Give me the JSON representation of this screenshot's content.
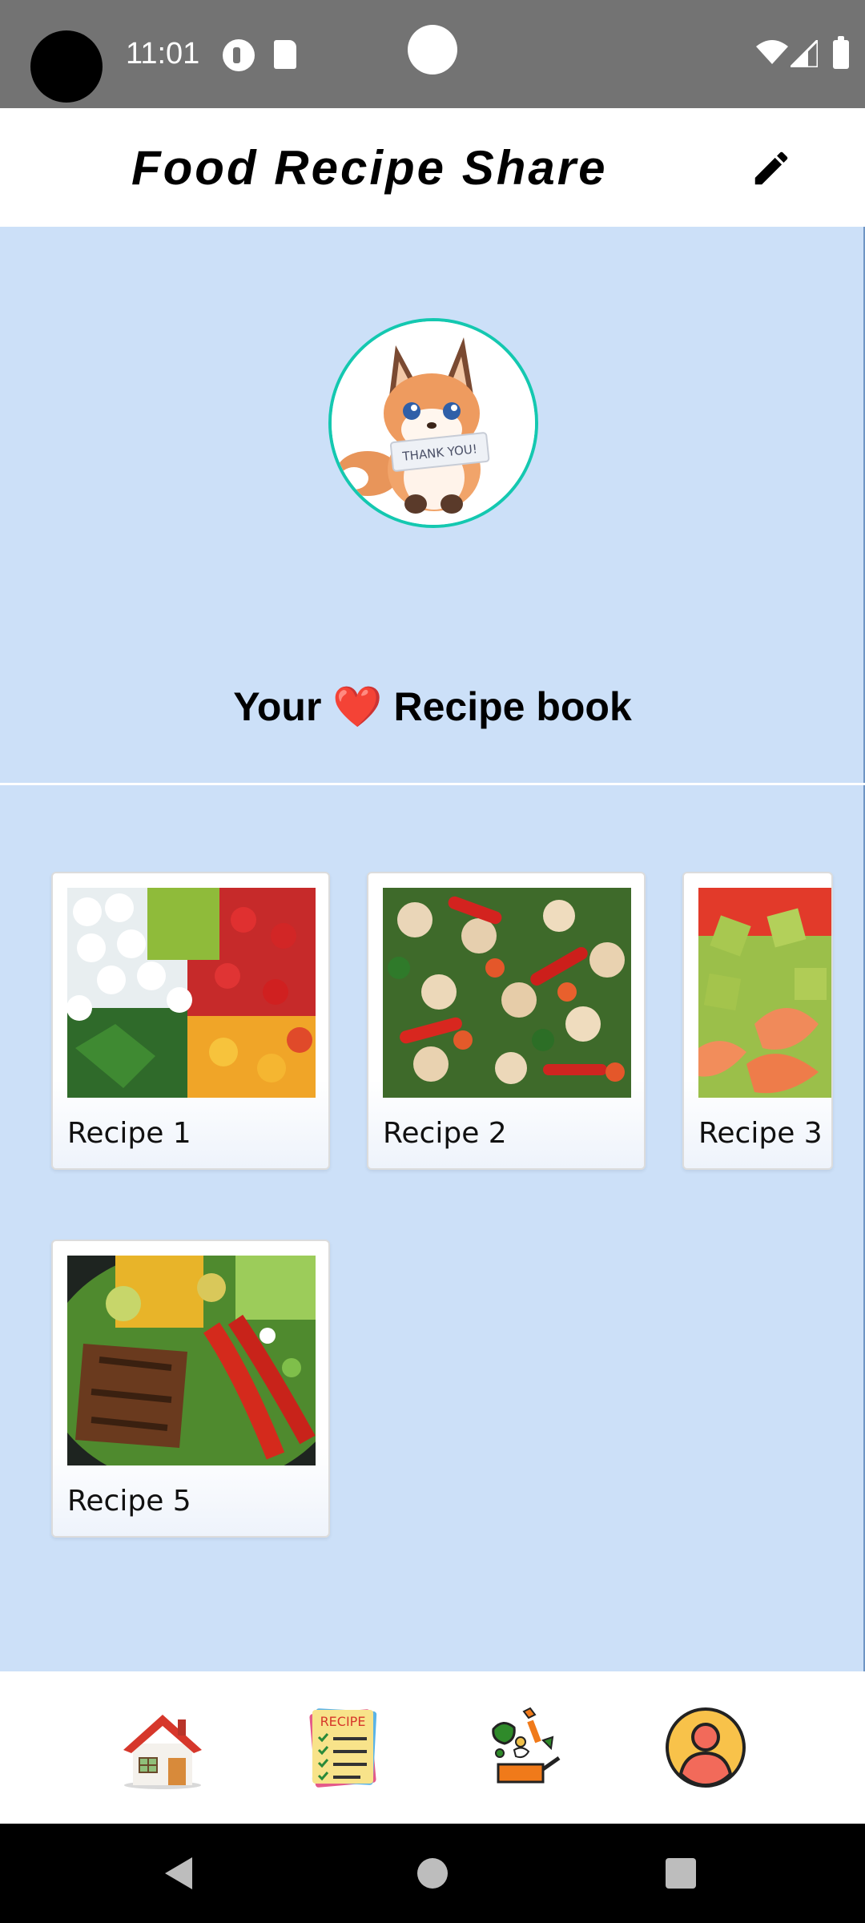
{
  "status_bar": {
    "time": "11:01"
  },
  "app_bar": {
    "title": "Food Recipe Share",
    "edit_icon": "pencil-icon"
  },
  "profile": {
    "avatar": "fox-thank-you-avatar",
    "avatar_text": "THANK YOU!"
  },
  "recipe_book": {
    "title_prefix": "Your",
    "title_heart": "❤️",
    "title_suffix": "Recipe book"
  },
  "recipes": [
    {
      "label": "Recipe 1"
    },
    {
      "label": "Recipe 2"
    },
    {
      "label": "Recipe 3"
    },
    {
      "label": "Recipe 5"
    }
  ],
  "bottom_nav": {
    "items": [
      {
        "icon": "home-icon"
      },
      {
        "icon": "recipe-list-icon"
      },
      {
        "icon": "cooking-ingredients-icon"
      },
      {
        "icon": "profile-icon"
      }
    ]
  },
  "colors": {
    "status_bar": "#737373",
    "content_bg": "#cce0f8",
    "avatar_ring": "#14c8b0",
    "heart": "#e02424"
  }
}
